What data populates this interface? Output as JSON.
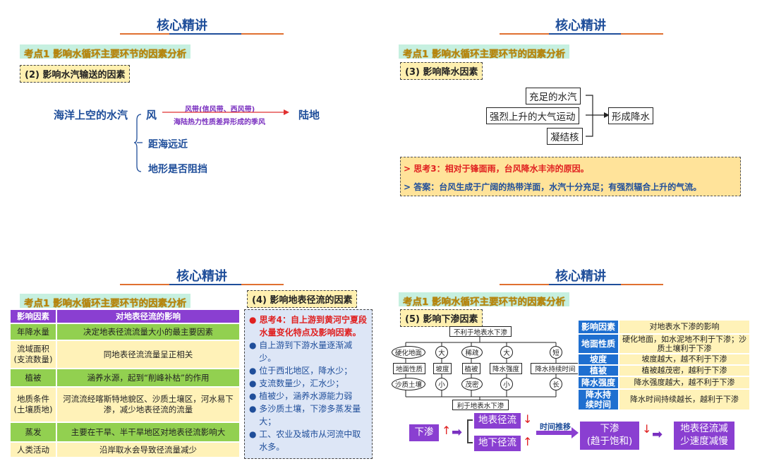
{
  "slide_title": "核心精讲",
  "kaodian": "考点1 影响水循环主要环节的因素分析",
  "s1": {
    "tag": "(2) 影响水汽输送的因素",
    "source": "海洋上空的水汽",
    "wind": "风",
    "top": "风带(信风带、西风带)",
    "bottom": "海陆热力性质差异形成的季风",
    "dest": "陆地",
    "f2": "距海远近",
    "f3": "地形是否阻挡"
  },
  "s2": {
    "tag": "(3) 影响降水因素",
    "c1": "充足的水汽",
    "c2": "强烈上升的大气运动",
    "c3": "凝结核",
    "result": "形成降水",
    "q": "> 思考3：相对于锋面雨，台风降水丰沛的原因。",
    "a": "> 答案：台风生成于广阔的热带洋面，水汽十分充足；有强烈辐合上升的气流。"
  },
  "s3": {
    "tag": "(4) 影响地表径流的因素",
    "h1": "影响因素",
    "h2": "对地表径流的影响",
    "rows": [
      [
        "年降水量",
        "决定地表径流流量大小的最主要因素"
      ],
      [
        "流域面积\n(支流数量)",
        "同地表径流流量呈正相关"
      ],
      [
        "植被",
        "涵养水源，起到“削峰补枯”的作用"
      ],
      [
        "地质条件\n(土壤质地)",
        "河流流经喀斯特地貌区、沙质土壤区，河水易下渗，减少地表径流的流量"
      ],
      [
        "蒸发",
        "主要在干旱、半干旱地区对地表径流影响大"
      ],
      [
        "人类活动",
        "沿岸取水会导致径流量减少"
      ]
    ],
    "q": "思考4：自上游到黄河宁夏段水量变化特点及影响因素。",
    "bullets": [
      "自上游到下游水量逐渐减少。",
      "位于西北地区，降水少；",
      "支流数量少，汇水少；",
      "植被少，涵养水源能力弱",
      "多沙质土壤，下渗多蒸发量大；",
      "工、农业及城市从河流中取水多。"
    ]
  },
  "s4": {
    "tag": "(5) 影响下渗因素",
    "top": "不利于地表水下渗",
    "bottom": "利于地表水下渗",
    "l1": [
      "硬化地面",
      "大",
      "稀疏",
      "大",
      "短"
    ],
    "l2": [
      "地面性质",
      "坡度",
      "植被",
      "降水强度",
      "降水持续时间"
    ],
    "l3": [
      "沙质土壤",
      "小",
      "茂密",
      "小",
      "长"
    ],
    "h1": "影响因素",
    "h2": "对地表水下渗的影响",
    "rows": [
      [
        "地面性质",
        "硬化地面，如水泥地不利于下渗；沙质土壤利于下渗"
      ],
      [
        "坡度",
        "坡度越大，越不利于下渗"
      ],
      [
        "植被",
        "植被越茂密，越利于下渗"
      ],
      [
        "降水强度",
        "降水强度越大，越不利于下渗"
      ],
      [
        "降水持续时间",
        "降水时间持续越长，越利于下渗"
      ]
    ],
    "f1": "下渗",
    "f2": "地表径流",
    "f3": "地下径流",
    "f4": "时间推移",
    "f5a": "下渗",
    "f5b": "(趋于饱和)",
    "f6": "地表径流减少速度减慢"
  }
}
